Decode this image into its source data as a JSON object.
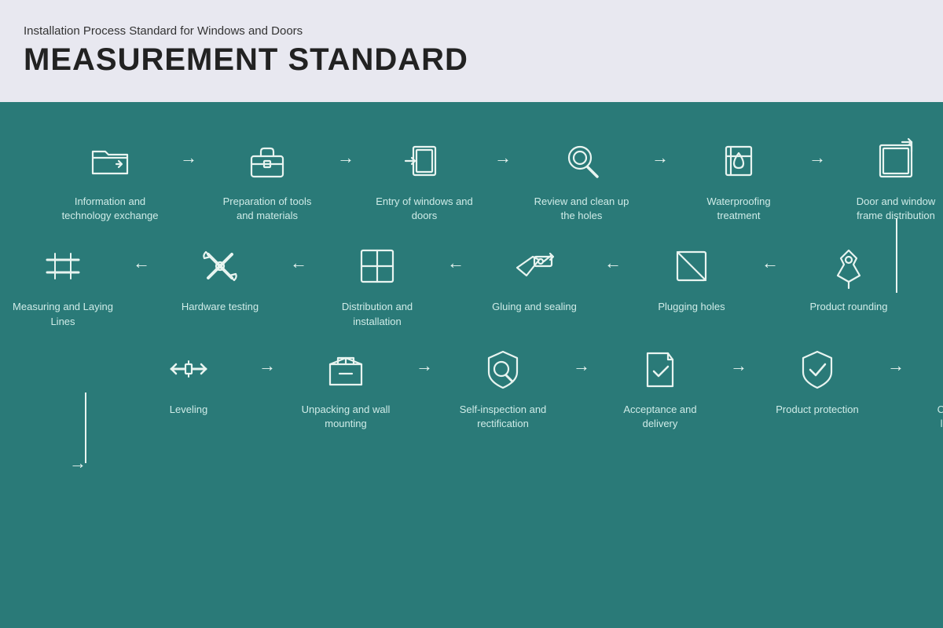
{
  "header": {
    "subtitle": "Installation Process Standard for Windows and Doors",
    "title": "MEASUREMENT STANDARD"
  },
  "row1": [
    {
      "id": "info-exchange",
      "label": "Information and technology exchange",
      "icon": "folder"
    },
    {
      "id": "prep-tools",
      "label": "Preparation of tools and materials",
      "icon": "toolbox"
    },
    {
      "id": "entry-windows",
      "label": "Entry of windows and doors",
      "icon": "door-entry"
    },
    {
      "id": "review-holes",
      "label": "Review and clean up the holes",
      "icon": "search-hole"
    },
    {
      "id": "waterproofing",
      "label": "Waterproofing treatment",
      "icon": "waterproof"
    },
    {
      "id": "frame-dist",
      "label": "Door and window frame distribution",
      "icon": "frame-dist"
    }
  ],
  "row2": [
    {
      "id": "measuring",
      "label": "Measuring and Laying Lines",
      "icon": "measuring"
    },
    {
      "id": "hardware",
      "label": "Hardware testing",
      "icon": "hardware"
    },
    {
      "id": "dist-install",
      "label": "Distribution and installation",
      "icon": "dist-install"
    },
    {
      "id": "gluing",
      "label": "Gluing and sealing",
      "icon": "gluing"
    },
    {
      "id": "plugging",
      "label": "Plugging holes",
      "icon": "plugging"
    },
    {
      "id": "rounding",
      "label": "Product rounding",
      "icon": "rounding"
    }
  ],
  "row3": [
    {
      "id": "leveling",
      "label": "Leveling",
      "icon": "leveling"
    },
    {
      "id": "unpacking",
      "label": "Unpacking and wall mounting",
      "icon": "unpacking"
    },
    {
      "id": "self-inspect",
      "label": "Self-inspection and rectification",
      "icon": "self-inspect"
    },
    {
      "id": "acceptance",
      "label": "Acceptance and delivery",
      "icon": "acceptance"
    },
    {
      "id": "protection",
      "label": "Product protection",
      "icon": "protection"
    },
    {
      "id": "cleanup",
      "label": "Cleaning up and leaving the site",
      "icon": "cleanup"
    }
  ],
  "arrows": {
    "right": "→",
    "left": "←"
  }
}
